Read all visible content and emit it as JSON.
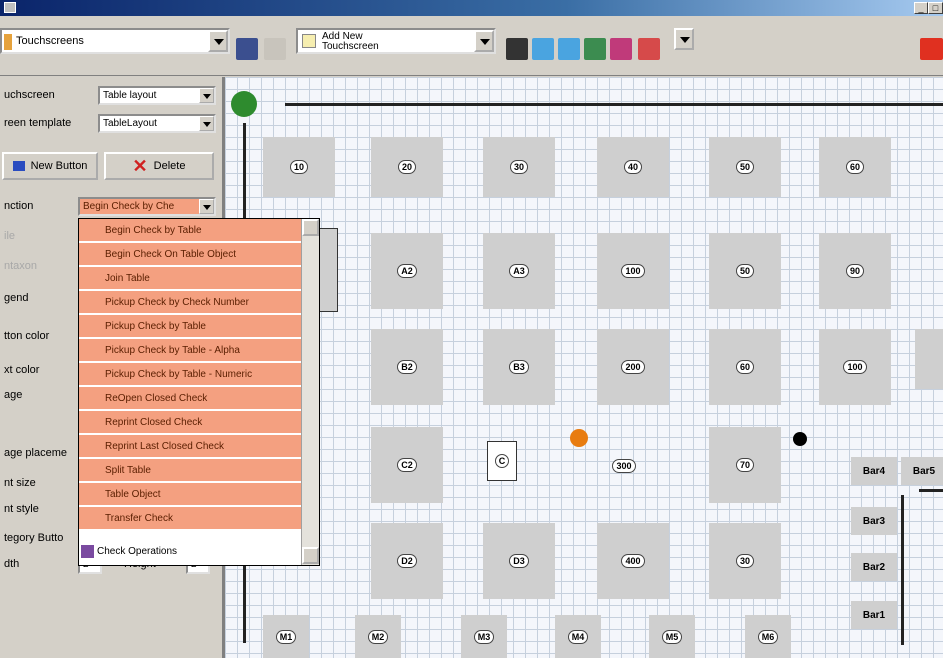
{
  "toolbar": {
    "screen_combo": "Touchscreens",
    "action_combo_line1": "Add New",
    "action_combo_line2": "Touchscreen"
  },
  "left": {
    "touchscreen_label": "uchscreen",
    "touchscreen_value": "Table layout",
    "template_label": "reen template",
    "template_value": "TableLayout",
    "new_button": "New Button",
    "delete_button": "Delete",
    "function_label": "nction",
    "function_value": "Begin Check by Che",
    "legend_label": "gend",
    "button_color_label": "tton color",
    "text_color_label": "xt color",
    "image_label": "age",
    "image_placement_label": "age placeme",
    "font_size_label": "nt size",
    "font_style_label": "nt style",
    "category_label": "tegory Butto",
    "width_label": "dth",
    "width_value": "2",
    "height_label": "Height",
    "height_value": "2"
  },
  "dropdown": {
    "items": [
      "Begin Check by Table",
      "Begin Check On Table Object",
      "Join Table",
      "Pickup Check by Check Number",
      "Pickup Check by Table",
      "Pickup Check by Table - Alpha",
      "Pickup Check by Table - Numeric",
      "ReOpen Closed Check",
      "Reprint Closed Check",
      "Reprint Last Closed Check",
      "Split Table",
      "Table Object",
      "Transfer Check"
    ],
    "category": "Check Operations"
  },
  "tables": {
    "row1": [
      "10",
      "20",
      "30",
      "40",
      "50",
      "60"
    ],
    "row2": [
      "A2",
      "A3",
      "100",
      "50",
      "90"
    ],
    "row3": [
      "B2",
      "B3",
      "200",
      "60",
      "100"
    ],
    "row4": [
      "C2",
      "C",
      "300",
      "70"
    ],
    "row5": [
      "D2",
      "D3",
      "400",
      "30"
    ],
    "row6": [
      "M1",
      "M2",
      "M3",
      "M4",
      "M5",
      "M6"
    ],
    "bars": [
      "Bar4",
      "Bar5",
      "Bar3",
      "Bar2",
      "Bar1"
    ]
  }
}
